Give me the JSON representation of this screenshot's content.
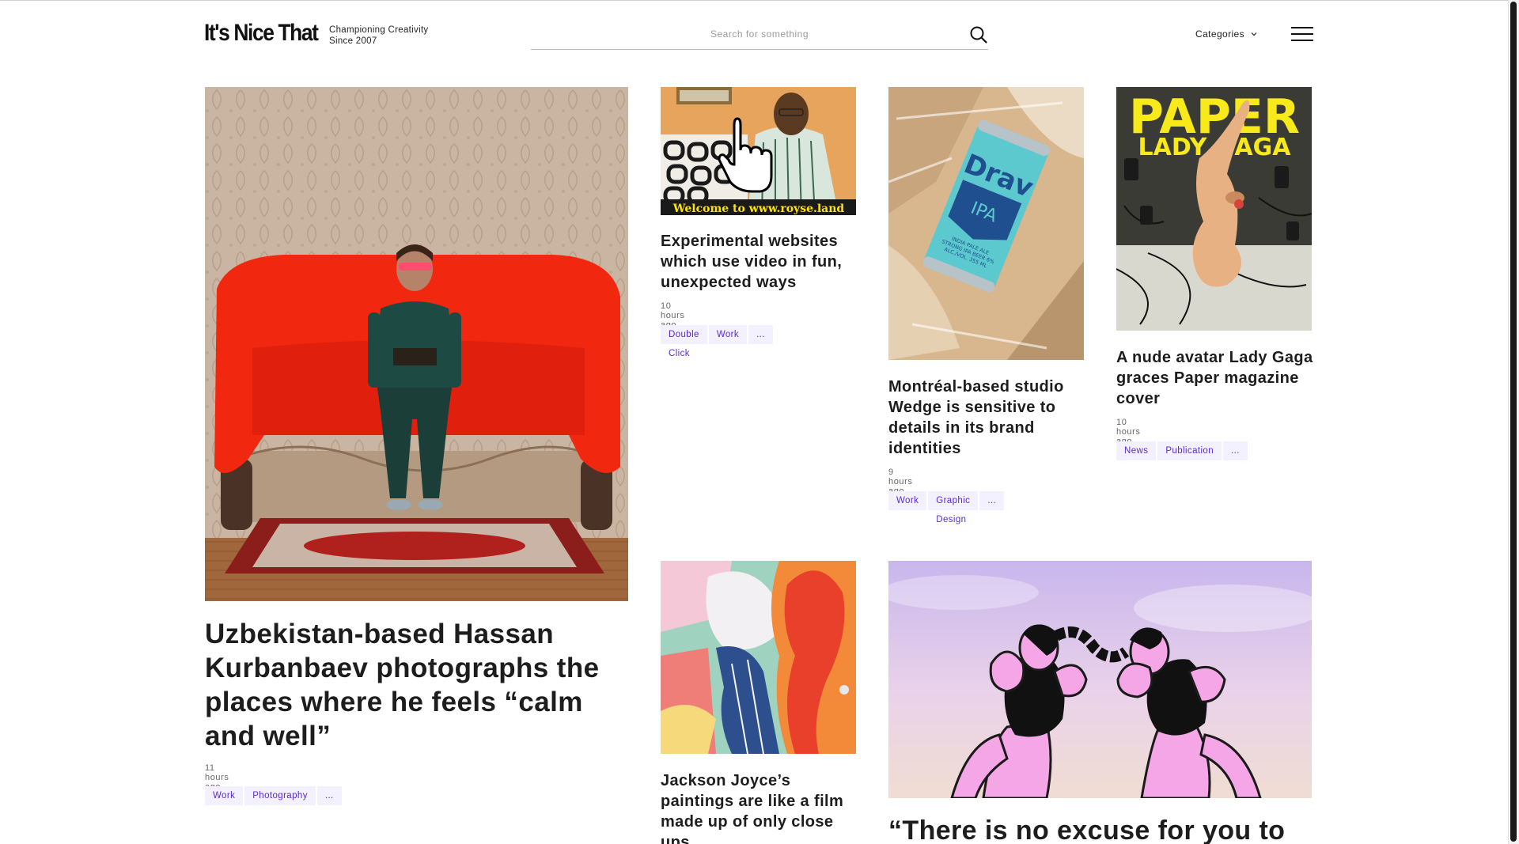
{
  "header": {
    "logo": "It's Nice That",
    "tagline_line1": "Championing Creativity",
    "tagline_line2": "Since 2007",
    "search_placeholder": "Search for something",
    "categories_label": "Categories"
  },
  "articles": [
    {
      "title": "Uzbekistan-based Hassan Kurbanbaev photographs the places where he feels “calm and well”",
      "time": "11 hours ago",
      "tags": [
        "Work",
        "Photography",
        "..."
      ]
    },
    {
      "title": "Experimental websites which use video in fun, unexpected ways",
      "time": "10 hours ago",
      "tags": [
        "Double Click",
        "Work",
        "..."
      ],
      "image_caption": "Welcome to www.royse.land"
    },
    {
      "title": "Montréal-based studio Wedge is sensitive to details in its brand identities",
      "time": "9 hours ago",
      "tags": [
        "Work",
        "Graphic Design",
        "..."
      ],
      "image_text_brand": "Drav",
      "image_text_style": "IPA",
      "image_text_small": "INDIA PALE ALE STRONG IPA BEER 6% ALC./VOL. 355 ML"
    },
    {
      "title": "A nude avatar Lady Gaga graces Paper magazine cover",
      "time": "10 hours ago",
      "tags": [
        "News",
        "Publication",
        "..."
      ],
      "image_text_masthead": "PAPER",
      "image_text_cover": "LADY GAGA"
    },
    {
      "title": "Jackson Joyce’s paintings are like a film made up of only close ups"
    },
    {
      "title": "“There is no excuse for you to"
    }
  ],
  "colors": {
    "tag_bg": "#f3f0ff",
    "tag_text": "#5a2bd6",
    "sofa_red": "#f2270f"
  }
}
